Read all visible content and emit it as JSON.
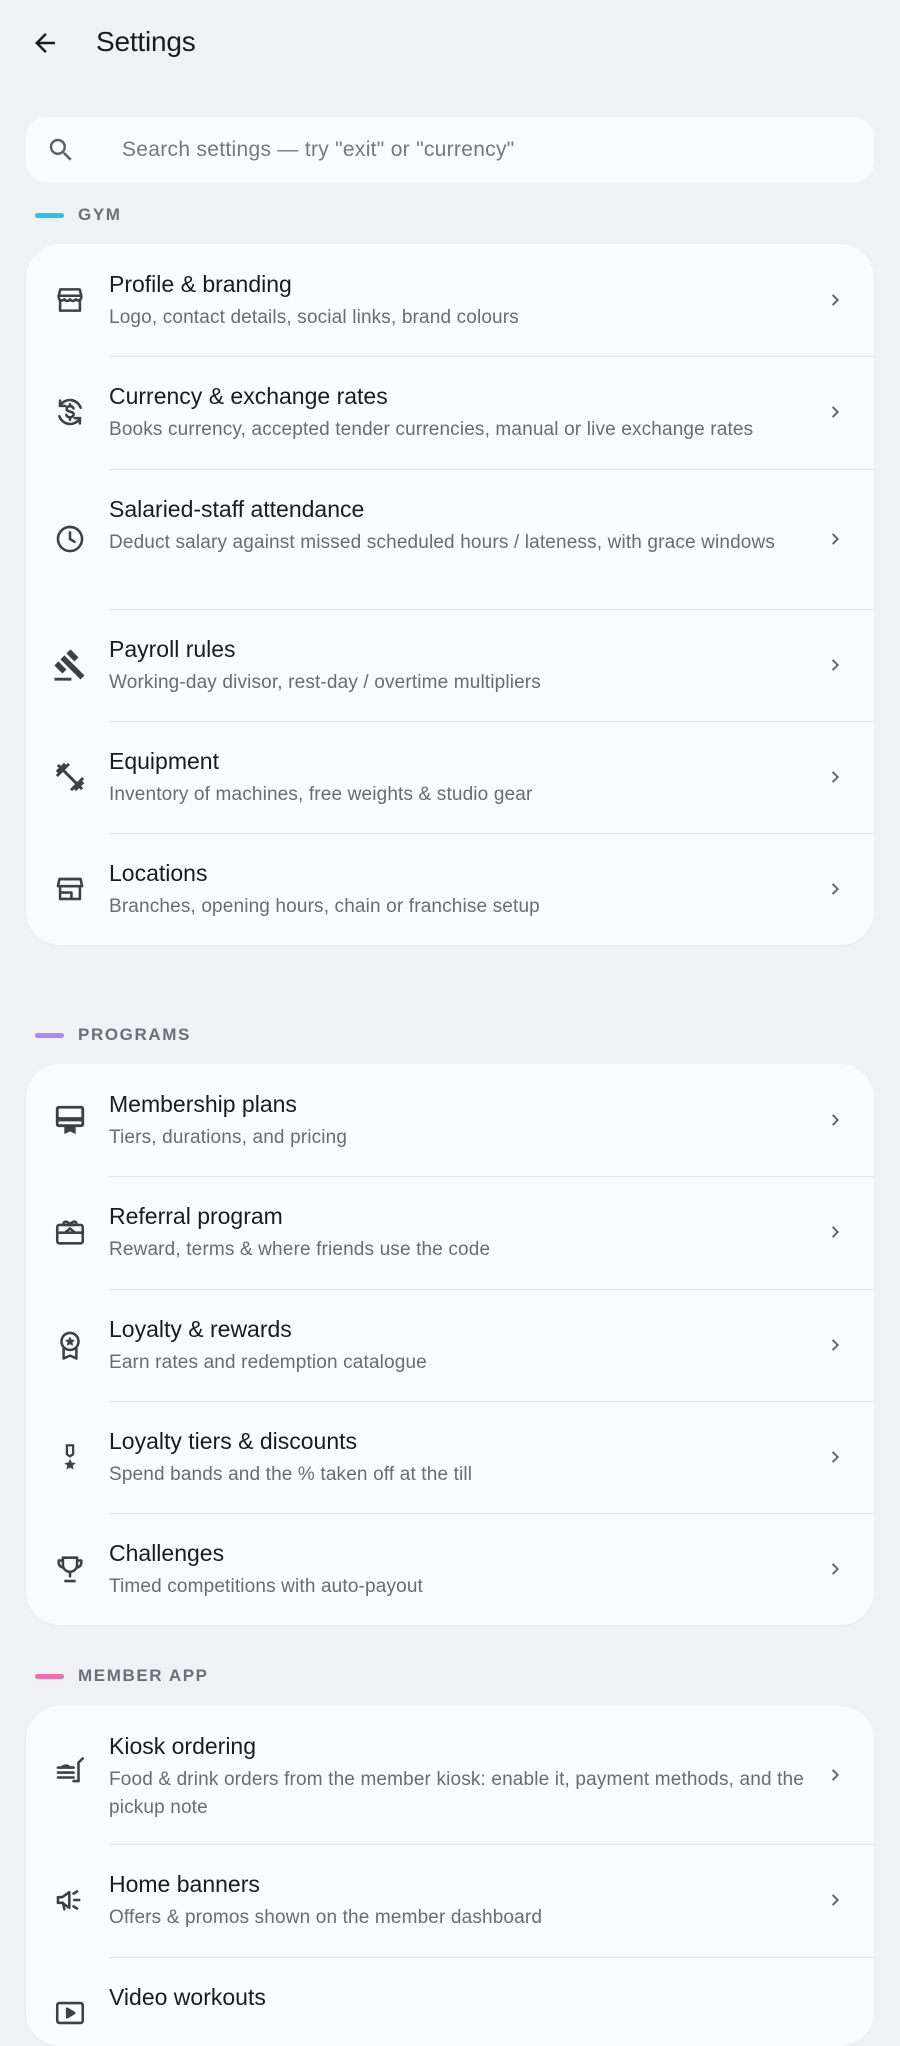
{
  "header": {
    "title": "Settings",
    "back_icon": "arrow-left-icon"
  },
  "search": {
    "placeholder": "Search settings — try \"exit\" or \"currency\"",
    "value": "",
    "icon": "search-icon"
  },
  "colors": {
    "gym_accent": "#22c8e6",
    "programs_accent": "#a98af0",
    "member_app_accent": "#ec6fa6",
    "background": "#f0f1f5",
    "card": "#fafbfe"
  },
  "sections": [
    {
      "label": "GYM",
      "items": [
        {
          "icon": "storefront-icon",
          "title": "Profile & branding",
          "subtitle": "Logo, contact details, social links, brand colours"
        },
        {
          "icon": "currency-exchange-icon",
          "title": "Currency & exchange rates",
          "subtitle": "Books currency, accepted tender currencies, manual or live exchange rates"
        },
        {
          "icon": "clock-icon",
          "title": "Salaried-staff attendance",
          "subtitle": "Deduct salary against missed scheduled hours / lateness, with grace windows"
        },
        {
          "icon": "gavel-icon",
          "title": "Payroll rules",
          "subtitle": "Working-day divisor, rest-day / overtime multipliers"
        },
        {
          "icon": "dumbbell-icon",
          "title": "Equipment",
          "subtitle": "Inventory of machines, free weights & studio gear"
        },
        {
          "icon": "store-icon",
          "title": "Locations",
          "subtitle": "Branches, opening hours, chain or franchise setup"
        }
      ]
    },
    {
      "label": "PROGRAMS",
      "items": [
        {
          "icon": "card-membership-icon",
          "title": "Membership plans",
          "subtitle": "Tiers, durations, and pricing"
        },
        {
          "icon": "gift-card-icon",
          "title": "Referral program",
          "subtitle": "Reward, terms & where friends use the code"
        },
        {
          "icon": "award-star-icon",
          "title": "Loyalty & rewards",
          "subtitle": "Earn rates and redemption catalogue"
        },
        {
          "icon": "military-tech-icon",
          "title": "Loyalty tiers & discounts",
          "subtitle": "Spend bands and the % taken off at the till"
        },
        {
          "icon": "trophy-icon",
          "title": "Challenges",
          "subtitle": "Timed competitions with auto-payout"
        }
      ]
    },
    {
      "label": "MEMBER APP",
      "items": [
        {
          "icon": "kiosk-order-icon",
          "title": "Kiosk ordering",
          "subtitle": "Food & drink orders from the member kiosk: enable it, payment methods, and the pickup note"
        },
        {
          "icon": "campaign-icon",
          "title": "Home banners",
          "subtitle": "Offers & promos shown on the member dashboard"
        },
        {
          "icon": "video-icon",
          "title": "Video workouts",
          "subtitle": ""
        }
      ]
    }
  ]
}
